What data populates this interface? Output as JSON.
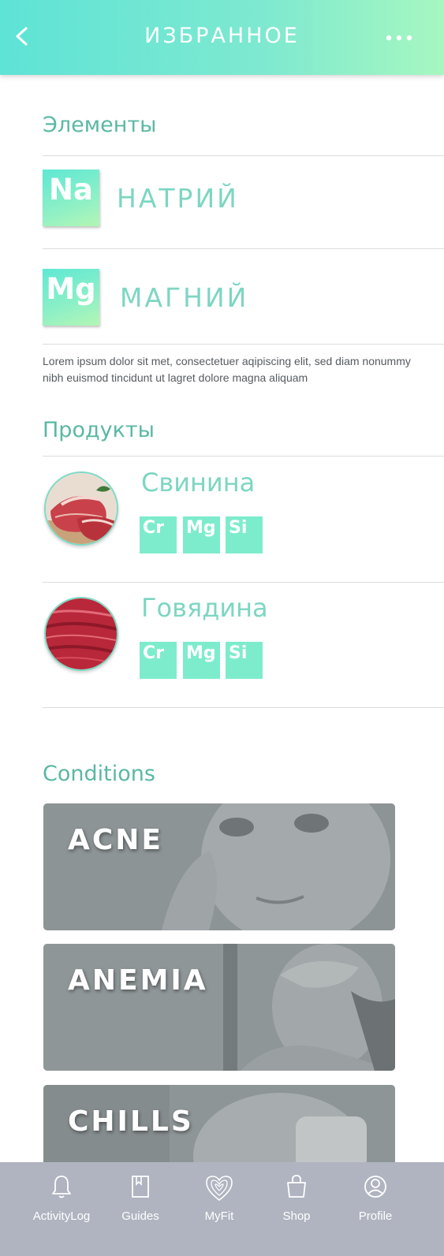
{
  "header": {
    "title": "ИЗБРАННОЕ",
    "back_icon": "chevron-left-icon",
    "more_icon": "more-dots-icon"
  },
  "elements_section": {
    "title": "Элементы",
    "items": [
      {
        "symbol": "Na",
        "name": "НАТРИЙ"
      },
      {
        "symbol": "Mg",
        "name": "МАГНИЙ"
      }
    ],
    "description": "Lorem ipsum dolor sit met, consectetuer aqipiscing elit, sed diam nonummy nibh euismod tincidunt ut lagret dolore magna aliquam"
  },
  "products_section": {
    "title": "Продукты",
    "items": [
      {
        "name": "Свинина",
        "elements": [
          "Cr",
          "Mg",
          "Si"
        ]
      },
      {
        "name": "Говядина",
        "elements": [
          "Cr",
          "Mg",
          "Si"
        ]
      }
    ]
  },
  "conditions_section": {
    "title": "Conditions",
    "items": [
      {
        "label": "ACNE"
      },
      {
        "label": "ANEMIA"
      },
      {
        "label": "CHILLS"
      }
    ]
  },
  "tabbar": {
    "items": [
      {
        "label": "ActivityLog",
        "icon": "bell-icon"
      },
      {
        "label": "Guides",
        "icon": "book-icon"
      },
      {
        "label": "MyFit",
        "icon": "fingerprint-heart-icon"
      },
      {
        "label": "Shop",
        "icon": "shopping-bag-icon"
      },
      {
        "label": "Profile",
        "icon": "user-icon"
      }
    ]
  },
  "colors": {
    "accent": "#5ee3d6",
    "accent_end": "#a6f7c0",
    "section_title": "#5ab8a4",
    "text_mint": "#7dd6c2",
    "chip": "#7deccd",
    "tabbar": "#b0b4c0"
  }
}
